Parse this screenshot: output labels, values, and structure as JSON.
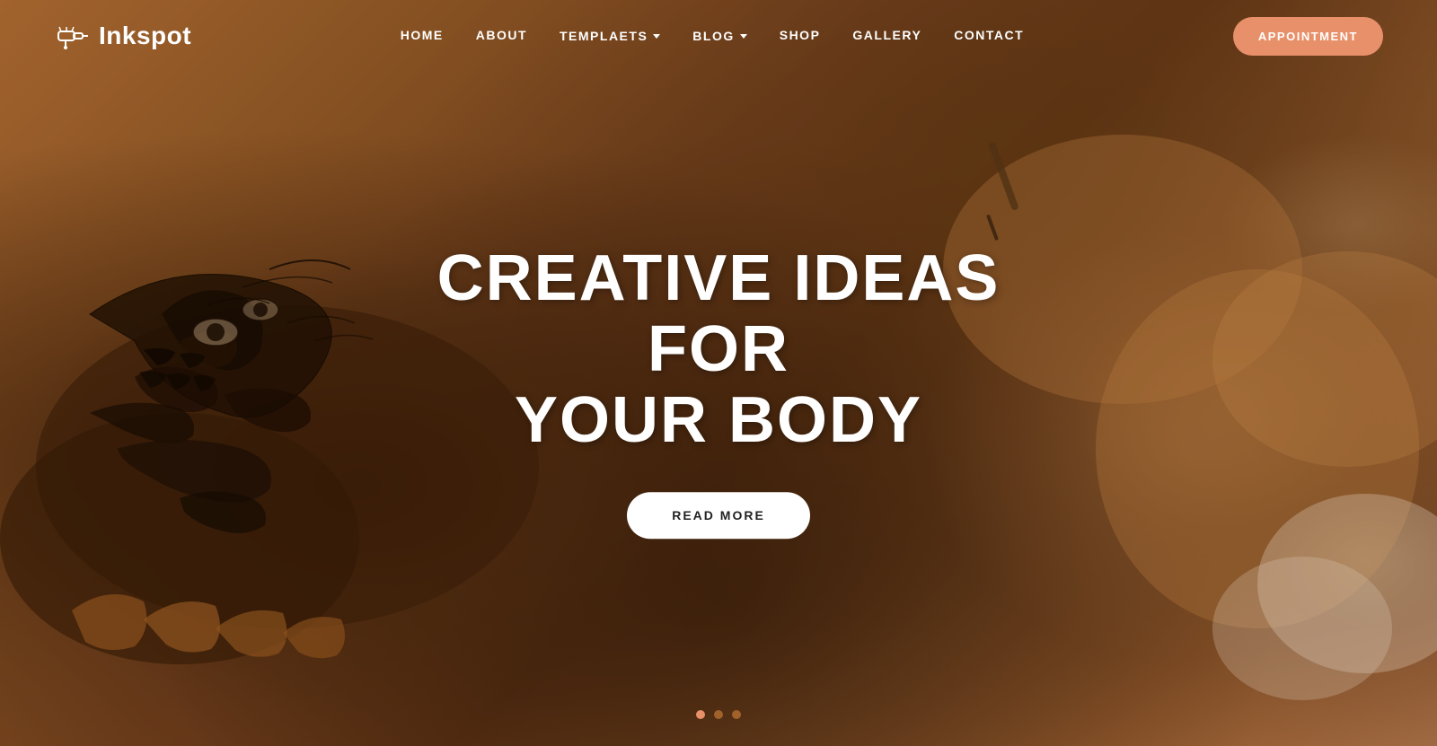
{
  "brand": {
    "name": "Inkspot",
    "logo_alt": "Inkspot tattoo studio logo"
  },
  "nav": {
    "items": [
      {
        "label": "HOME",
        "has_dropdown": false
      },
      {
        "label": "ABOUT",
        "has_dropdown": false
      },
      {
        "label": "TEMPLAETS",
        "has_dropdown": true
      },
      {
        "label": "BLOG",
        "has_dropdown": true
      },
      {
        "label": "SHOP",
        "has_dropdown": false
      },
      {
        "label": "GALLERY",
        "has_dropdown": false
      },
      {
        "label": "CONTACT",
        "has_dropdown": false
      }
    ],
    "cta_label": "APPOINTMENT"
  },
  "hero": {
    "title_line1": "CREATIVE IDEAS FOR",
    "title_line2": "YOUR BODY",
    "cta_label": "READ MORE"
  },
  "slider": {
    "dots": [
      {
        "state": "active"
      },
      {
        "state": "inactive"
      },
      {
        "state": "inactive"
      }
    ]
  },
  "colors": {
    "accent": "#e8906a",
    "background": "#8B5E3C",
    "text_white": "#ffffff",
    "dot_active": "#e8906a",
    "dot_inactive": "#a0622a"
  }
}
